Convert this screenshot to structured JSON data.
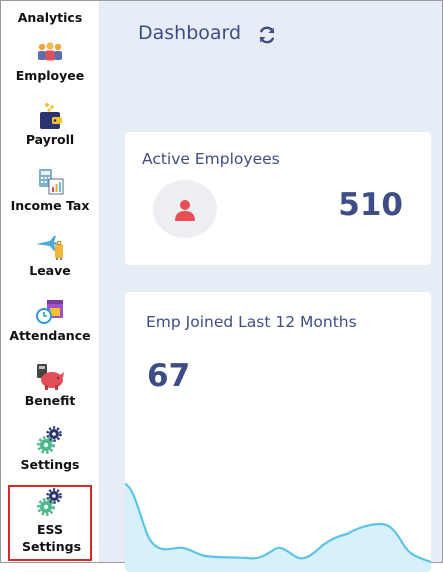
{
  "sidebar": {
    "items": [
      {
        "label": "Analytics",
        "icon": "analytics-icon"
      },
      {
        "label": "Employee",
        "icon": "employee-group-icon"
      },
      {
        "label": "Payroll",
        "icon": "wallet-icon"
      },
      {
        "label": "Income Tax",
        "icon": "calculator-chart-icon"
      },
      {
        "label": "Leave",
        "icon": "airplane-luggage-icon"
      },
      {
        "label": "Attendance",
        "icon": "clock-calendar-icon"
      },
      {
        "label": "Benefit",
        "icon": "piggy-bank-icon"
      },
      {
        "label": "Settings",
        "icon": "gears-icon"
      },
      {
        "label": "ESS Settings",
        "icon": "gears-icon",
        "highlighted": true
      }
    ]
  },
  "main": {
    "title": "Dashboard",
    "cards": {
      "active_employees": {
        "title": "Active Employees",
        "value": "510"
      },
      "emp_joined": {
        "title": "Emp Joined Last 12 Months",
        "value": "67"
      }
    }
  },
  "colors": {
    "accent": "#3f4d86",
    "background": "#e7edf6",
    "highlight_border": "#d8272d",
    "chart_line": "#5bc4e6",
    "chart_fill": "#d6f1fb",
    "person_icon": "#e94e57"
  }
}
